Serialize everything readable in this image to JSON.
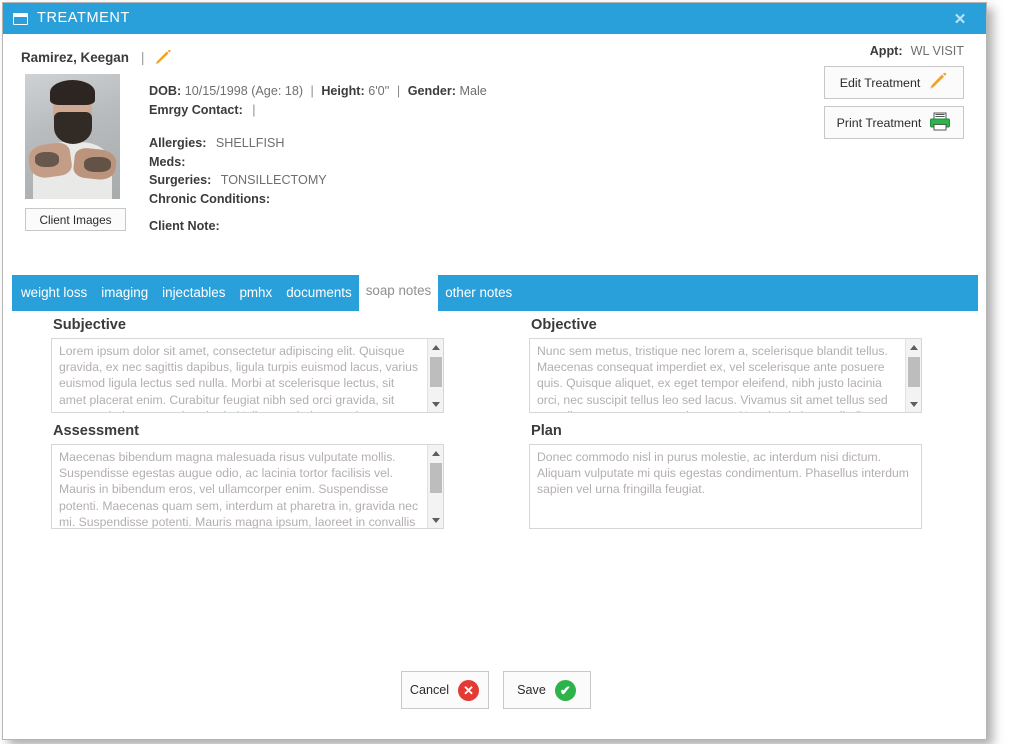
{
  "window": {
    "title": "TREATMENT",
    "title_icon": "window-icon",
    "close_label": "✕",
    "accent_color": "#2aa0db"
  },
  "patient": {
    "name": "Ramirez, Keegan",
    "name_separator": "|",
    "edit_name_icon": "pencil-icon",
    "photo_alt": "client-photo",
    "client_images_label": "Client Images",
    "fields": {
      "dob_label": "DOB:",
      "dob_value": "10/15/1998 (Age: 18)",
      "height_label": "Height:",
      "height_value": "6'0''",
      "gender_label": "Gender:",
      "gender_value": "Male",
      "emrgy_label": "Emrgy Contact:",
      "emrgy_value": "|",
      "allergies_label": "Allergies:",
      "allergies_value": "SHELLFISH",
      "meds_label": "Meds:",
      "meds_value": "",
      "surgeries_label": "Surgeries:",
      "surgeries_value": "TONSILLECTOMY",
      "chronic_label": "Chronic Conditions:",
      "chronic_value": "",
      "client_note_label": "Client Note:",
      "client_note_value": ""
    },
    "separator": "|"
  },
  "appointment": {
    "label": "Appt:",
    "value": "WL VISIT",
    "edit_treatment_label": "Edit Treatment",
    "edit_treatment_icon": "pencil-icon",
    "print_treatment_label": "Print Treatment",
    "print_treatment_icon": "printer-icon"
  },
  "tabs": [
    {
      "label": "weight loss",
      "active": false
    },
    {
      "label": "imaging",
      "active": false
    },
    {
      "label": "injectables",
      "active": false
    },
    {
      "label": "pmhx",
      "active": false
    },
    {
      "label": "documents",
      "active": false
    },
    {
      "label": "soap notes",
      "active": true
    },
    {
      "label": "other notes",
      "active": false
    }
  ],
  "soap": {
    "subjective": {
      "label": "Subjective",
      "text": "Lorem ipsum dolor sit amet, consectetur adipiscing elit. Quisque gravida, ex nec sagittis dapibus, ligula turpis euismod lacus, varius euismod ligula lectus sed nulla. Morbi at scelerisque lectus, sit amet placerat enim. Curabitur feugiat nibh sed orci gravida, sit amet scelerisque eros hendrerit. Nullam scelerisque vulputate fringilla."
    },
    "objective": {
      "label": "Objective",
      "text": "Nunc sem metus, tristique nec lorem a, scelerisque blandit tellus. Maecenas consequat imperdiet ex, vel scelerisque ante posuere quis. Quisque aliquet, ex eget tempor eleifend, nibh justo lacinia orci, nec suscipit tellus leo sed lacus. Vivamus sit amet tellus sed sem dictum consectetur sed ac ante. Nam in tristique velit. Donec volutpat"
    },
    "assessment": {
      "label": "Assessment",
      "text": "Maecenas bibendum magna malesuada risus vulputate mollis. Suspendisse egestas augue odio, ac lacinia tortor facilisis vel. Mauris in bibendum eros, vel ullamcorper enim. Suspendisse potenti. Maecenas quam sem, interdum at pharetra in, gravida nec mi. Suspendisse potenti. Mauris magna ipsum, laoreet in convallis ac"
    },
    "plan": {
      "label": "Plan",
      "text": "Donec commodo nisl in purus molestie, ac interdum nisi dictum. Aliquam vulputate mi quis egestas condimentum. Phasellus interdum sapien vel urna fringilla feugiat."
    }
  },
  "footer": {
    "cancel_label": "Cancel",
    "cancel_icon": "error-circle-icon",
    "cancel_glyph": "✕",
    "cancel_color": "#e23b35",
    "save_label": "Save",
    "save_icon": "check-circle-icon",
    "save_glyph": "✔",
    "save_color": "#2cb34a"
  }
}
